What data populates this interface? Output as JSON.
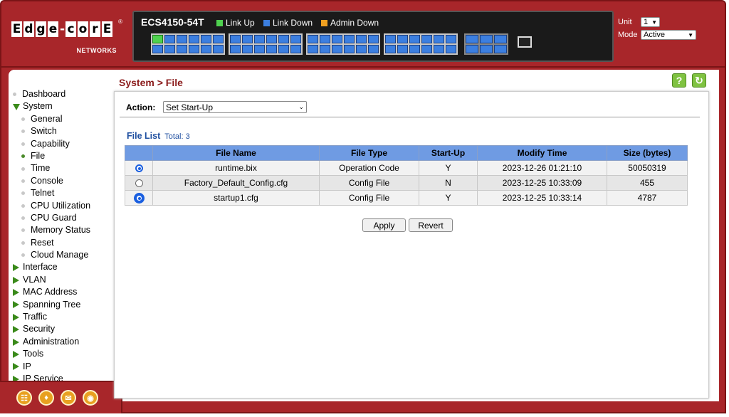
{
  "header": {
    "logo_letters": [
      "E",
      "d",
      "g",
      "e",
      "-",
      "c",
      "o",
      "r",
      "E"
    ],
    "logo_sub": "NETWORKS",
    "logo_reg": "®",
    "model": "ECS4150-54T",
    "legend": {
      "link_up": "Link Up",
      "link_down": "Link Down",
      "admin_down": "Admin Down",
      "colors": {
        "link_up": "#4fd24f",
        "link_down": "#3c7fe0",
        "admin_down": "#f0a020"
      }
    },
    "unit_label": "Unit",
    "unit_value": "1",
    "mode_label": "Mode",
    "mode_value": "Active"
  },
  "sidebar": {
    "items": [
      {
        "label": "Dashboard",
        "type": "bullet"
      },
      {
        "label": "System",
        "type": "expanded"
      },
      {
        "label": "General",
        "type": "sub"
      },
      {
        "label": "Switch",
        "type": "sub"
      },
      {
        "label": "Capability",
        "type": "sub"
      },
      {
        "label": "File",
        "type": "sub-active"
      },
      {
        "label": "Time",
        "type": "sub"
      },
      {
        "label": "Console",
        "type": "sub"
      },
      {
        "label": "Telnet",
        "type": "sub"
      },
      {
        "label": "CPU Utilization",
        "type": "sub"
      },
      {
        "label": "CPU Guard",
        "type": "sub"
      },
      {
        "label": "Memory Status",
        "type": "sub"
      },
      {
        "label": "Reset",
        "type": "sub"
      },
      {
        "label": "Cloud Manage",
        "type": "sub"
      },
      {
        "label": "Interface",
        "type": "collapsed"
      },
      {
        "label": "VLAN",
        "type": "collapsed"
      },
      {
        "label": "MAC Address",
        "type": "collapsed"
      },
      {
        "label": "Spanning Tree",
        "type": "collapsed"
      },
      {
        "label": "Traffic",
        "type": "collapsed"
      },
      {
        "label": "Security",
        "type": "collapsed"
      },
      {
        "label": "Administration",
        "type": "collapsed"
      },
      {
        "label": "Tools",
        "type": "collapsed"
      },
      {
        "label": "IP",
        "type": "collapsed"
      },
      {
        "label": "IP Service",
        "type": "collapsed"
      }
    ]
  },
  "page": {
    "title": "System > File",
    "help_glyph": "?",
    "refresh_glyph": "↻",
    "action_label": "Action:",
    "action_value": "Set Start-Up",
    "file_list_title": "File List",
    "file_list_total": "Total: 3",
    "columns": [
      "File Name",
      "File Type",
      "Start-Up",
      "Modify Time",
      "Size (bytes)"
    ],
    "rows": [
      {
        "name": "runtime.bix",
        "type": "Operation Code",
        "startup": "Y",
        "time": "2023-12-26 01:21:10",
        "size": "50050319",
        "selected": "on"
      },
      {
        "name": "Factory_Default_Config.cfg",
        "type": "Config File",
        "startup": "N",
        "time": "2023-12-25 10:33:09",
        "size": "455",
        "selected": "off"
      },
      {
        "name": "startup1.cfg",
        "type": "Config File",
        "startup": "Y",
        "time": "2023-12-25 10:33:14",
        "size": "4787",
        "selected": "focus"
      }
    ],
    "apply_label": "Apply",
    "revert_label": "Revert"
  },
  "bottom_icons": [
    "sitemap-icon",
    "shield-icon",
    "mail-icon",
    "globe-icon"
  ]
}
